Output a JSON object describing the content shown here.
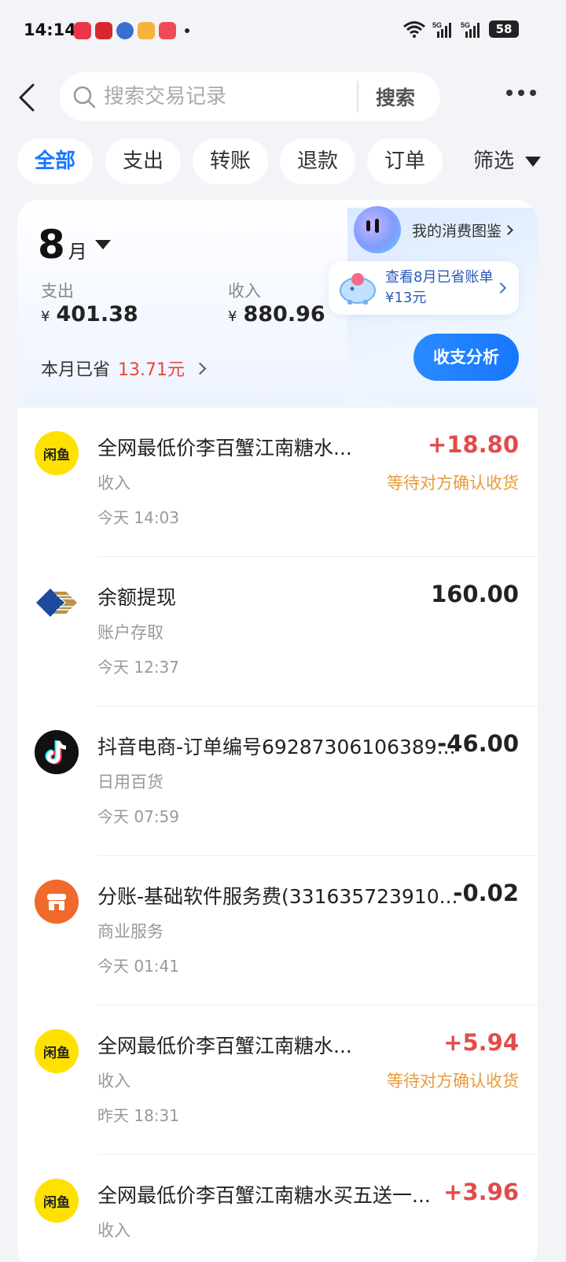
{
  "status_bar": {
    "time": "14:14",
    "network": "5G",
    "battery": "58",
    "app_icon_colors": [
      "#e8374a",
      "#d8282e",
      "#3a6fd0",
      "#f4b33b",
      "#f04a5a"
    ]
  },
  "header": {
    "search_placeholder": "搜索交易记录",
    "search_button": "搜索"
  },
  "tabs": [
    {
      "label": "全部",
      "active": true
    },
    {
      "label": "支出",
      "active": false
    },
    {
      "label": "转账",
      "active": false
    },
    {
      "label": "退款",
      "active": false
    },
    {
      "label": "订单",
      "active": false
    }
  ],
  "filter_label": "筛选",
  "summary": {
    "month_num": "8",
    "month_unit": "月",
    "expense_label": "支出",
    "expense_currency": "¥",
    "expense_value": "401.38",
    "income_label": "收入",
    "income_currency": "¥",
    "income_value": "880.96",
    "saved_label": "本月已省",
    "saved_value": "13.71元",
    "gallery_label": "我的消费图鉴",
    "bubble_text": "查看8月已省账单¥13元",
    "analysis_button": "收支分析"
  },
  "transactions": [
    {
      "logo": "xianyu-icon",
      "logo_text": "闲鱼",
      "title": "全网最低价李百蟹江南糖水...",
      "category": "收入",
      "time": "今天 14:03",
      "amount": "+18.80",
      "status": "等待对方确认收货"
    },
    {
      "logo": "bank-icon",
      "title": "余额提现",
      "category": "账户存取",
      "time": "今天 12:37",
      "amount": "160.00",
      "status": ""
    },
    {
      "logo": "douyin-icon",
      "title": "抖音电商-订单编号69287306106389...",
      "category": "日用百货",
      "time": "今天 07:59",
      "amount": "-46.00",
      "status": ""
    },
    {
      "logo": "shop-icon",
      "title": "分账-基础软件服务费(331635723910...",
      "category": "商业服务",
      "time": "今天 01:41",
      "amount": "-0.02",
      "status": ""
    },
    {
      "logo": "xianyu-icon",
      "logo_text": "闲鱼",
      "title": "全网最低价李百蟹江南糖水...",
      "category": "收入",
      "time": "昨天 18:31",
      "amount": "+5.94",
      "status": "等待对方确认收货"
    },
    {
      "logo": "xianyu-icon",
      "logo_text": "闲鱼",
      "title": "全网最低价李百蟹江南糖水买五送一...",
      "category": "收入",
      "time": "",
      "amount": "+3.96",
      "status": ""
    }
  ],
  "colors": {
    "accent": "#1677ff",
    "positive_amount": "#e24b4b",
    "pending_status": "#e89b3c",
    "saved_value": "#e8453c"
  }
}
